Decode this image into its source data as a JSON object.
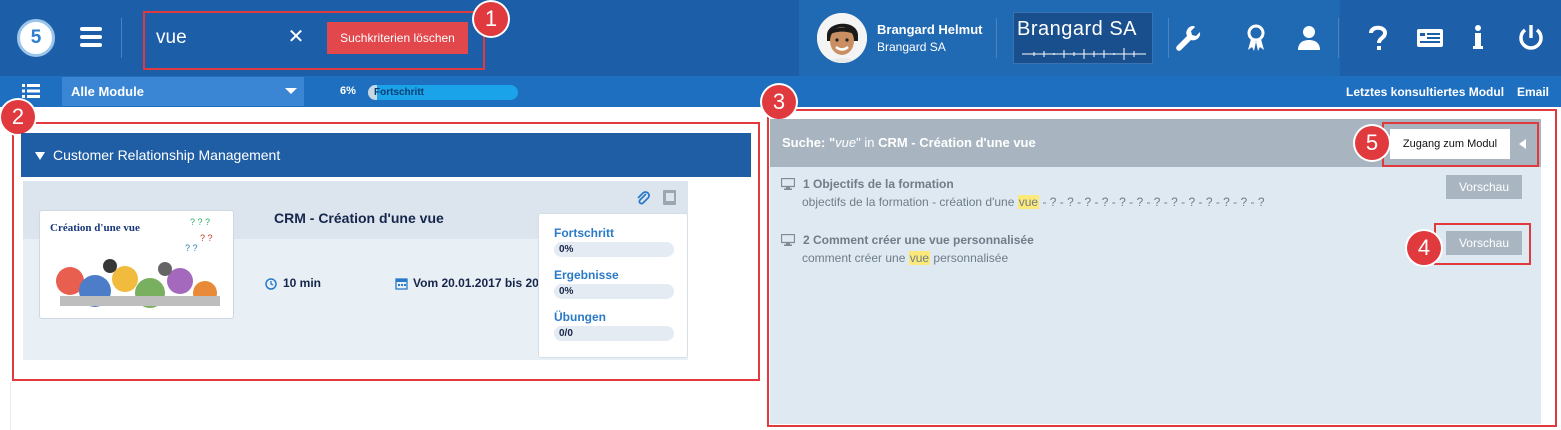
{
  "app": {
    "logo_text": "5"
  },
  "search": {
    "value": "vue",
    "clear_glyph": "✕",
    "clear_criteria_label": "Suchkriterien löschen"
  },
  "user": {
    "name": "Brangard Helmut",
    "company": "Brangard SA"
  },
  "brand": {
    "logo_text": "Brangard SA"
  },
  "toolbar_icons": [
    "wrench-icon",
    "award-icon",
    "user-icon",
    "help-icon",
    "card-icon",
    "info-icon",
    "power-icon"
  ],
  "subbar": {
    "module_select": "Alle Module",
    "progress_percent": "6%",
    "progress_value": 0.06,
    "progress_label": "Fortschritt",
    "last_module_link": "Letztes konsultiertes Modul",
    "email_link": "Email"
  },
  "annotations": [
    "1",
    "2",
    "3",
    "4",
    "5"
  ],
  "left_panel": {
    "category": "Customer Relationship Management",
    "course": {
      "thumbnail_title": "Création d'une vue",
      "title": "CRM - Création d'une vue",
      "duration": "10 min",
      "date_range": "Vom 20.01.2017 bis 20",
      "stats": [
        {
          "label": "Fortschritt",
          "value": "0%"
        },
        {
          "label": "Ergebnisse",
          "value": "0%"
        },
        {
          "label": "Übungen",
          "value": "0/0"
        }
      ]
    }
  },
  "right_panel": {
    "title_prefix": "Suche: \"",
    "title_term": "vue",
    "title_middle": "\" in ",
    "title_module": "CRM - Création d'une vue",
    "access_button": "Zugang zum Modul",
    "results": [
      {
        "title": "1 Objectifs de la formation",
        "desc_before": "objectifs de la formation - création d'une ",
        "desc_highlight": "vue",
        "desc_after": " - ? - ? - ? - ? - ? - ? - ? - ? - ? - ? - ? - ? - ?",
        "preview_label": "Vorschau"
      },
      {
        "title": "2 Comment créer une vue personnalisée",
        "desc_before": "comment créer une ",
        "desc_highlight": "vue",
        "desc_after": " personnalisée",
        "preview_label": "Vorschau"
      }
    ]
  }
}
